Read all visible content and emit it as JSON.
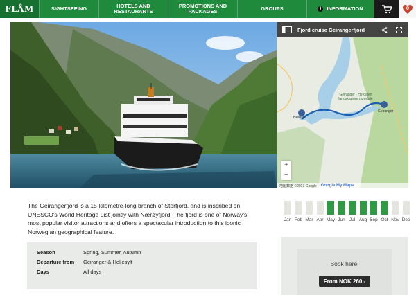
{
  "nav": {
    "logo": "FLÅM",
    "items": [
      {
        "label": "SIGHTSEEING"
      },
      {
        "label": "HOTELS AND RESTAURANTS"
      },
      {
        "label": "PROMOTIONS AND PACKAGES"
      },
      {
        "label": "GROUPS"
      },
      {
        "label": "INFORMATION",
        "icon": "info-icon"
      }
    ],
    "cart_icon": "cart-icon",
    "wishlist_count": "0",
    "colors": {
      "nav": "#1f8a3b",
      "accent": "#c8452f"
    }
  },
  "map": {
    "title": "Fjord cruise Geirangerfjord",
    "share_icon": "share-icon",
    "fullscreen_icon": "fullscreen-icon",
    "place_label": "Geiranger - Herdalen landskapsvernområde",
    "marker_left": "Hellesylt",
    "marker_right": "Geiranger",
    "zoom_in": "+",
    "zoom_out": "−",
    "footer_copyright": "地图数据 ©2017 Google",
    "footer_brand": "Google My Maps"
  },
  "description": "The Geirangerfjord is a 15-kilometre-long branch of Storfjord, and is inscribed on UNESCO's World Heritage List jointly with Nærøyfjord. The fjord is one of Norway's most popular visitor attractions and offers a spectacular introduction to this iconic Norwegian geographical feature.",
  "details": [
    {
      "key": "Season",
      "value": "Spring, Summer, Autumn"
    },
    {
      "key": "Departure from",
      "value": "Geiranger & Hellesylt"
    },
    {
      "key": "Days",
      "value": "All days"
    }
  ],
  "season_months": [
    {
      "label": "Jan",
      "active": false
    },
    {
      "label": "Feb",
      "active": false
    },
    {
      "label": "Mar",
      "active": false
    },
    {
      "label": "Apr",
      "active": false
    },
    {
      "label": "May",
      "active": true
    },
    {
      "label": "Jun",
      "active": true
    },
    {
      "label": "Jul",
      "active": true
    },
    {
      "label": "Aug",
      "active": true
    },
    {
      "label": "Sep",
      "active": true
    },
    {
      "label": "Oct",
      "active": true
    },
    {
      "label": "Nov",
      "active": false
    },
    {
      "label": "Dec",
      "active": false
    }
  ],
  "booking": {
    "label": "Book here:",
    "button": "From NOK 260,-"
  }
}
